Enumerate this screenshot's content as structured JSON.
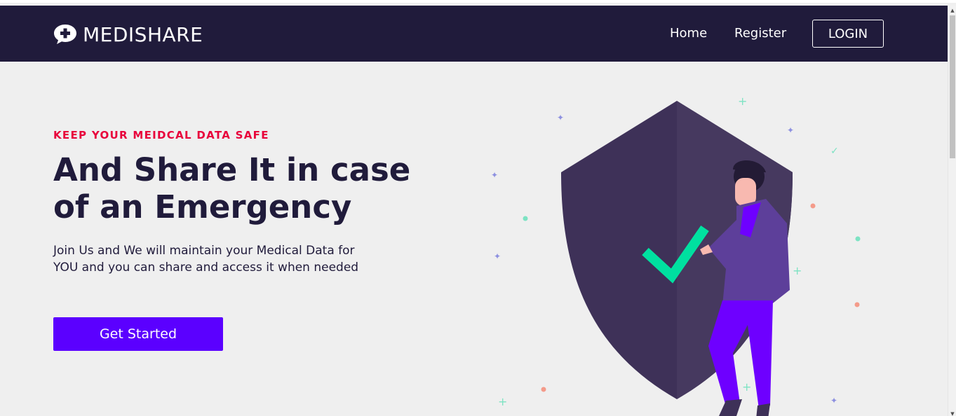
{
  "navbar": {
    "brand": "MEDISHARE",
    "brand_icon": "medical-chat-bubble-icon",
    "links": [
      {
        "label": "Home"
      },
      {
        "label": "Register"
      }
    ],
    "login_label": "LOGIN"
  },
  "hero": {
    "tagline": "KEEP YOUR MEIDCAL DATA SAFE",
    "headline": "And Share It in case of an Emergency",
    "description": "Join Us and We will maintain your Medical Data for YOU and you can share and access it when needed",
    "cta_label": "Get Started",
    "illustration": "shield-with-checkmark-and-person-illustration"
  },
  "colors": {
    "navbar_bg": "#201b3b",
    "accent_red": "#e8003b",
    "cta_purple": "#5b00ff",
    "shield": "#3e3158",
    "check": "#00e0a0"
  }
}
